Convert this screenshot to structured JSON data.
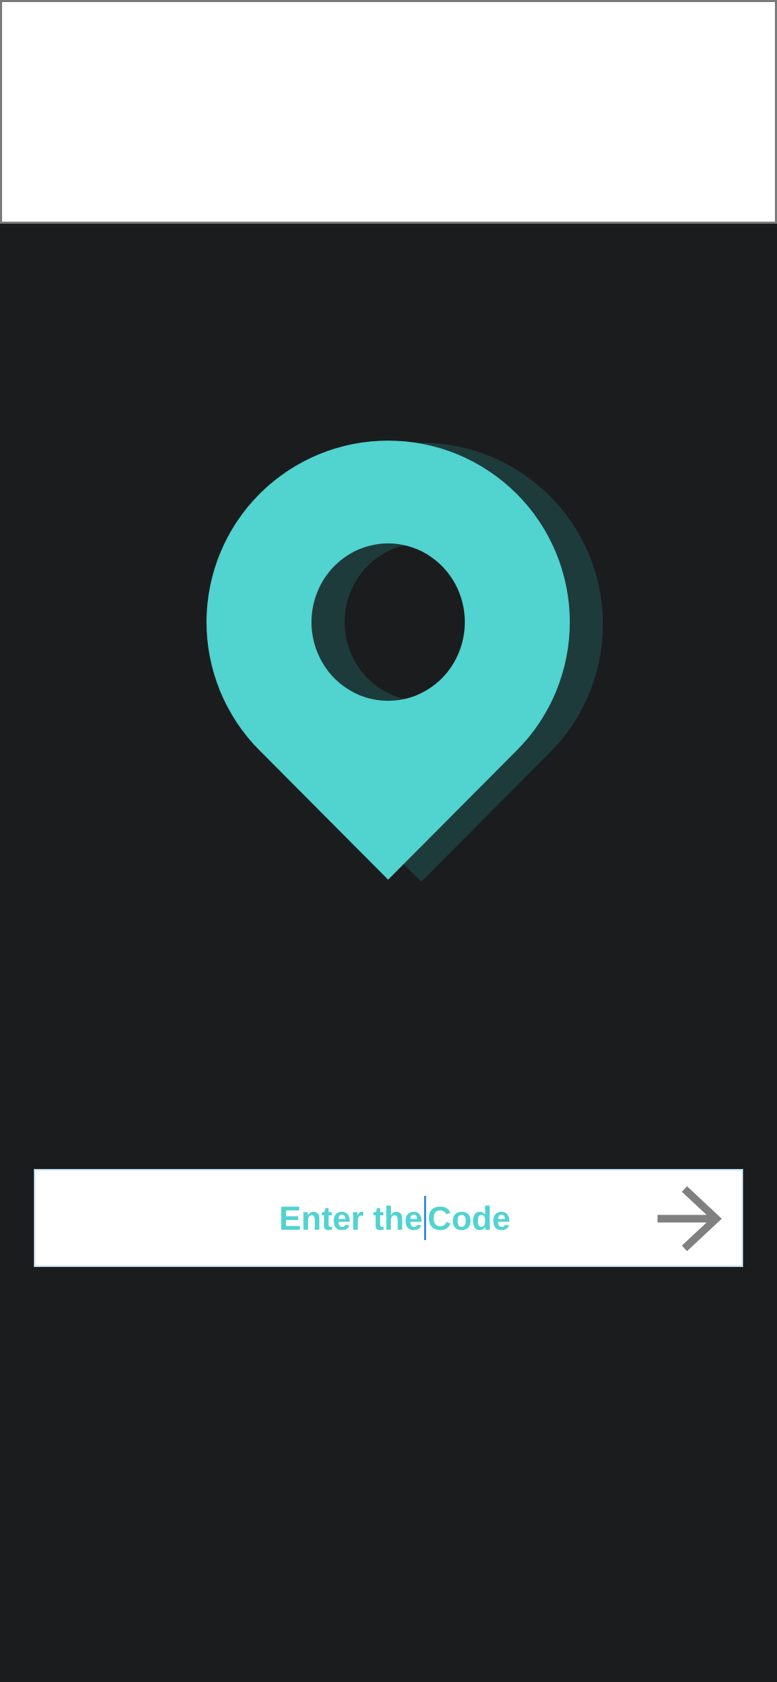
{
  "colors": {
    "background": "#1b1c1e",
    "top_bar": "#ffffff",
    "pin": "#51d3d0",
    "pin_shadow": "#1e3b3c",
    "placeholder_text": "#51d3d0",
    "arrow": "#808080",
    "input_border": "#b9d8ef",
    "caret": "#3d8ddb"
  },
  "logo": {
    "icon": "map-pin-icon"
  },
  "code_entry": {
    "placeholder_before_caret": "Enter the",
    "placeholder_after_caret": "Code",
    "submit_icon": "arrow-right-icon"
  }
}
